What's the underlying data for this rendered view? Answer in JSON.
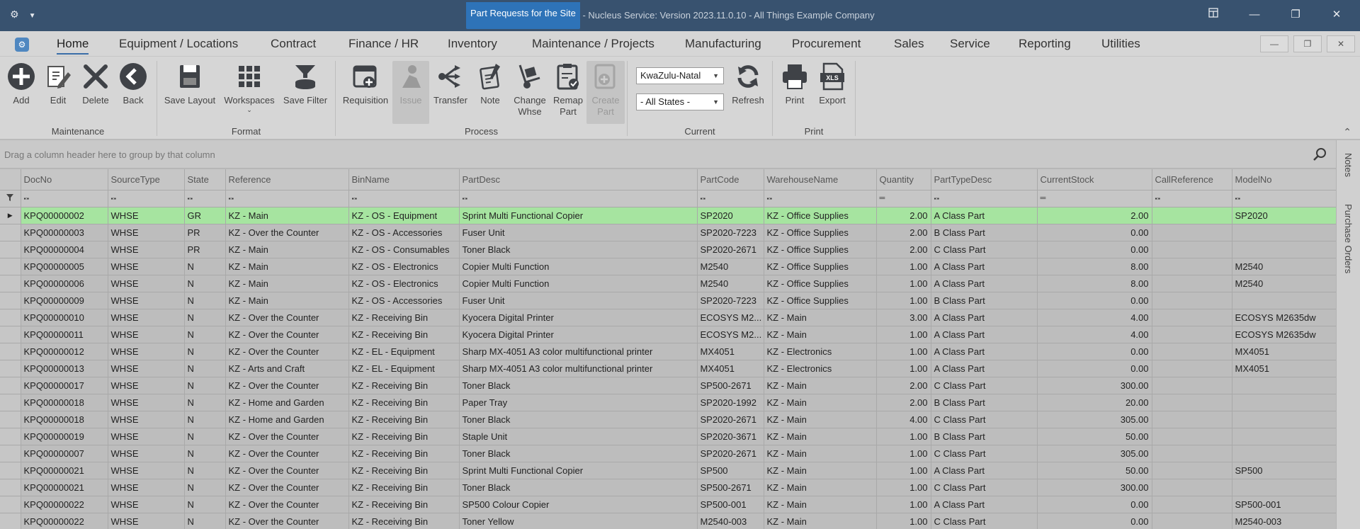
{
  "window": {
    "title_highlight": "Part Requests for the Site",
    "title_rest": " - Nucleus Service: Version 2023.11.0.10 - All Things Example Company"
  },
  "menu": {
    "tabs": [
      "Home",
      "Equipment / Locations",
      "Contract",
      "Finance / HR",
      "Inventory",
      "Maintenance / Projects",
      "Manufacturing",
      "Procurement",
      "Sales",
      "Service",
      "Reporting",
      "Utilities"
    ],
    "active": "Home"
  },
  "ribbon": {
    "groups": {
      "maintenance": "Maintenance",
      "format": "Format",
      "process": "Process",
      "current": "Current",
      "print": "Print"
    },
    "buttons": {
      "add": "Add",
      "edit": "Edit",
      "delete": "Delete",
      "back": "Back",
      "save_layout": "Save Layout",
      "workspaces": "Workspaces",
      "save_filter": "Save Filter",
      "requisition": "Requisition",
      "issue": "Issue",
      "transfer": "Transfer",
      "note": "Note",
      "change_whse_1": "Change",
      "change_whse_2": "Whse",
      "remap_part_1": "Remap",
      "remap_part_2": "Part",
      "create_part_1": "Create",
      "create_part_2": "Part",
      "refresh": "Refresh",
      "print": "Print",
      "export": "Export"
    },
    "region_select": "KwaZulu-Natal",
    "state_select": "- All States -"
  },
  "grouppanel": {
    "hint": "Drag a column header here to group by that column"
  },
  "sidetabs": {
    "notes": "Notes",
    "purchase_orders": "Purchase Orders"
  },
  "grid": {
    "columns": [
      "DocNo",
      "SourceType",
      "State",
      "Reference",
      "BinName",
      "PartDesc",
      "PartCode",
      "WarehouseName",
      "Quantity",
      "PartTypeDesc",
      "CurrentStock",
      "CallReference",
      "ModelNo"
    ],
    "rows": [
      [
        "KPQ00000002",
        "WHSE",
        "GR",
        "KZ - Main",
        "KZ - OS - Equipment",
        "Sprint Multi Functional Copier",
        "SP2020",
        "KZ - Office Supplies",
        "2.00",
        "A Class Part",
        "2.00",
        "",
        "SP2020"
      ],
      [
        "KPQ00000003",
        "WHSE",
        "PR",
        "KZ - Over the Counter",
        "KZ - OS - Accessories",
        "Fuser Unit",
        "SP2020-7223",
        "KZ - Office Supplies",
        "2.00",
        "B Class Part",
        "0.00",
        "",
        ""
      ],
      [
        "KPQ00000004",
        "WHSE",
        "PR",
        "KZ - Main",
        "KZ - OS - Consumables",
        "Toner Black",
        "SP2020-2671",
        "KZ - Office Supplies",
        "2.00",
        "C Class Part",
        "0.00",
        "",
        ""
      ],
      [
        "KPQ00000005",
        "WHSE",
        "N",
        "KZ - Main",
        "KZ - OS - Electronics",
        "Copier Multi Function",
        "M2540",
        "KZ - Office Supplies",
        "1.00",
        "A Class Part",
        "8.00",
        "",
        "M2540"
      ],
      [
        "KPQ00000006",
        "WHSE",
        "N",
        "KZ - Main",
        "KZ - OS - Electronics",
        "Copier Multi Function",
        "M2540",
        "KZ - Office Supplies",
        "1.00",
        "A Class Part",
        "8.00",
        "",
        "M2540"
      ],
      [
        "KPQ00000009",
        "WHSE",
        "N",
        "KZ - Main",
        "KZ - OS - Accessories",
        "Fuser Unit",
        "SP2020-7223",
        "KZ - Office Supplies",
        "1.00",
        "B Class Part",
        "0.00",
        "",
        ""
      ],
      [
        "KPQ00000010",
        "WHSE",
        "N",
        "KZ - Over the Counter",
        "KZ - Receiving Bin",
        "Kyocera Digital Printer",
        "ECOSYS M2...",
        "KZ - Main",
        "3.00",
        "A Class Part",
        "4.00",
        "",
        "ECOSYS M2635dw"
      ],
      [
        "KPQ00000011",
        "WHSE",
        "N",
        "KZ - Over the Counter",
        "KZ - Receiving Bin",
        "Kyocera Digital Printer",
        "ECOSYS M2...",
        "KZ - Main",
        "1.00",
        "A Class Part",
        "4.00",
        "",
        "ECOSYS M2635dw"
      ],
      [
        "KPQ00000012",
        "WHSE",
        "N",
        "KZ - Over the Counter",
        "KZ - EL - Equipment",
        "Sharp MX-4051 A3 color multifunctional printer",
        "MX4051",
        "KZ - Electronics",
        "1.00",
        "A Class Part",
        "0.00",
        "",
        "MX4051"
      ],
      [
        "KPQ00000013",
        "WHSE",
        "N",
        "KZ - Arts and Craft",
        "KZ - EL - Equipment",
        "Sharp MX-4051 A3 color multifunctional printer",
        "MX4051",
        "KZ - Electronics",
        "1.00",
        "A Class Part",
        "0.00",
        "",
        "MX4051"
      ],
      [
        "KPQ00000017",
        "WHSE",
        "N",
        "KZ - Over the Counter",
        "KZ - Receiving Bin",
        "Toner Black",
        "SP500-2671",
        "KZ - Main",
        "2.00",
        "C Class Part",
        "300.00",
        "",
        ""
      ],
      [
        "KPQ00000018",
        "WHSE",
        "N",
        "KZ - Home and Garden",
        "KZ - Receiving Bin",
        "Paper Tray",
        "SP2020-1992",
        "KZ - Main",
        "2.00",
        "B Class Part",
        "20.00",
        "",
        ""
      ],
      [
        "KPQ00000018",
        "WHSE",
        "N",
        "KZ - Home and Garden",
        "KZ - Receiving Bin",
        "Toner Black",
        "SP2020-2671",
        "KZ - Main",
        "4.00",
        "C Class Part",
        "305.00",
        "",
        ""
      ],
      [
        "KPQ00000019",
        "WHSE",
        "N",
        "KZ - Over the Counter",
        "KZ - Receiving Bin",
        "Staple Unit",
        "SP2020-3671",
        "KZ - Main",
        "1.00",
        "B Class Part",
        "50.00",
        "",
        ""
      ],
      [
        "KPQ00000007",
        "WHSE",
        "N",
        "KZ - Over the Counter",
        "KZ - Receiving Bin",
        "Toner Black",
        "SP2020-2671",
        "KZ - Main",
        "1.00",
        "C Class Part",
        "305.00",
        "",
        ""
      ],
      [
        "KPQ00000021",
        "WHSE",
        "N",
        "KZ - Over the Counter",
        "KZ - Receiving Bin",
        "Sprint Multi Functional Copier",
        "SP500",
        "KZ - Main",
        "1.00",
        "A Class Part",
        "50.00",
        "",
        "SP500"
      ],
      [
        "KPQ00000021",
        "WHSE",
        "N",
        "KZ - Over the Counter",
        "KZ - Receiving Bin",
        "Toner Black",
        "SP500-2671",
        "KZ - Main",
        "1.00",
        "C Class Part",
        "300.00",
        "",
        ""
      ],
      [
        "KPQ00000022",
        "WHSE",
        "N",
        "KZ - Over the Counter",
        "KZ - Receiving Bin",
        "SP500 Colour Copier",
        "SP500-001",
        "KZ - Main",
        "1.00",
        "A Class Part",
        "0.00",
        "",
        "SP500-001"
      ],
      [
        "KPQ00000022",
        "WHSE",
        "N",
        "KZ - Over the Counter",
        "KZ - Receiving Bin",
        "Toner Yellow",
        "M2540-003",
        "KZ - Main",
        "1.00",
        "C Class Part",
        "0.00",
        "",
        "M2540-003"
      ]
    ],
    "selected_row": 0,
    "numeric_columns": [
      8,
      10
    ]
  },
  "colors": {
    "titlebar": "#38526f",
    "title_highlight": "#2e73b8",
    "selected_row": "#a6e4a0",
    "ribbon": "#d6d6d6"
  }
}
